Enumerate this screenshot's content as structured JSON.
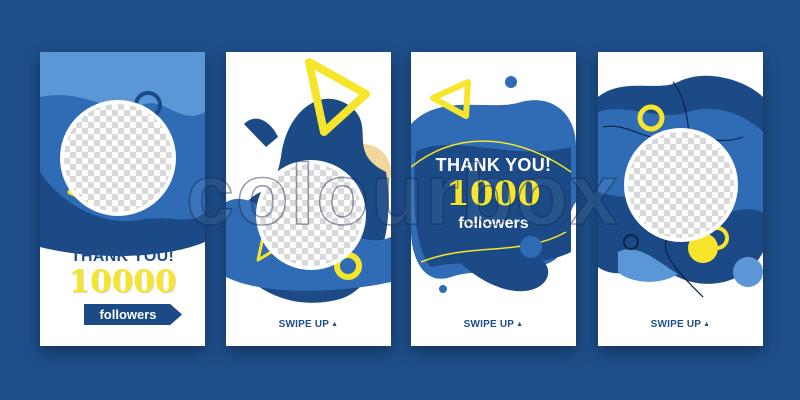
{
  "brand_colors": {
    "background": "#1e4e8a",
    "navy": "#1b4a86",
    "mid_blue": "#2f6cb5",
    "light_blue": "#5b96d6",
    "yellow": "#f6e52a",
    "white": "#ffffff"
  },
  "watermark": {
    "text": "colourbox"
  },
  "cards": [
    {
      "thanks": "THANK YOU!",
      "count": "10000",
      "followers": "followers"
    },
    {
      "swipe": "SWIPE UP",
      "swipe_icon": "triangle-up-icon"
    },
    {
      "thanks": "THANK YOU!",
      "count": "1000",
      "followers": "followers",
      "swipe": "SWIPE UP",
      "swipe_icon": "triangle-up-icon"
    },
    {
      "swipe": "SWIPE UP",
      "swipe_icon": "triangle-up-icon"
    }
  ]
}
